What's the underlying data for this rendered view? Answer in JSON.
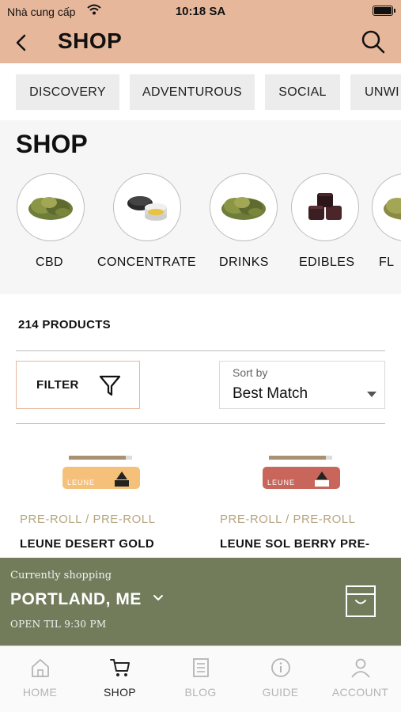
{
  "status_bar": {
    "carrier": "Nhà cung cấp",
    "time": "10:18 SA"
  },
  "nav": {
    "title": "SHOP"
  },
  "mood_tabs": [
    {
      "label": "DISCOVERY"
    },
    {
      "label": "ADVENTUROUS"
    },
    {
      "label": "SOCIAL"
    },
    {
      "label": "UNWI"
    }
  ],
  "shop_section": {
    "heading": "SHOP",
    "categories": [
      {
        "label": "CBD",
        "icon": "cannabis-flower-icon"
      },
      {
        "label": "CONCENTRATE",
        "icon": "concentrate-jar-icon"
      },
      {
        "label": "DRINKS",
        "icon": "cannabis-flower-icon"
      },
      {
        "label": "EDIBLES",
        "icon": "chocolate-edibles-icon"
      },
      {
        "label": "FL",
        "icon": "cannabis-flower-icon"
      }
    ]
  },
  "product_count": "214 PRODUCTS",
  "filter": {
    "label": "FILTER"
  },
  "sort": {
    "caption": "Sort by",
    "value": "Best Match"
  },
  "products": [
    {
      "category": "PRE-ROLL / PRE-ROLL",
      "name": "LEUNE DESERT GOLD",
      "brand": "LEUNE",
      "package_color": "#f5c17a"
    },
    {
      "category": "PRE-ROLL / PRE-ROLL",
      "name": "LEUNE SOL BERRY PRE-",
      "brand": "LEUNE",
      "package_color": "#c9665c"
    }
  ],
  "store": {
    "caption": "Currently shopping",
    "location": "PORTLAND, ME",
    "hours": "OPEN TIL 9:30 PM"
  },
  "tab_bar": [
    {
      "label": "HOME",
      "icon": "home-icon"
    },
    {
      "label": "SHOP",
      "icon": "cart-icon",
      "active": true
    },
    {
      "label": "BLOG",
      "icon": "blog-icon"
    },
    {
      "label": "GUIDE",
      "icon": "info-icon"
    },
    {
      "label": "ACCOUNT",
      "icon": "account-icon"
    }
  ],
  "colors": {
    "header": "#e7b79b",
    "store_bar": "#727c5b",
    "product_category": "#b6a682"
  }
}
